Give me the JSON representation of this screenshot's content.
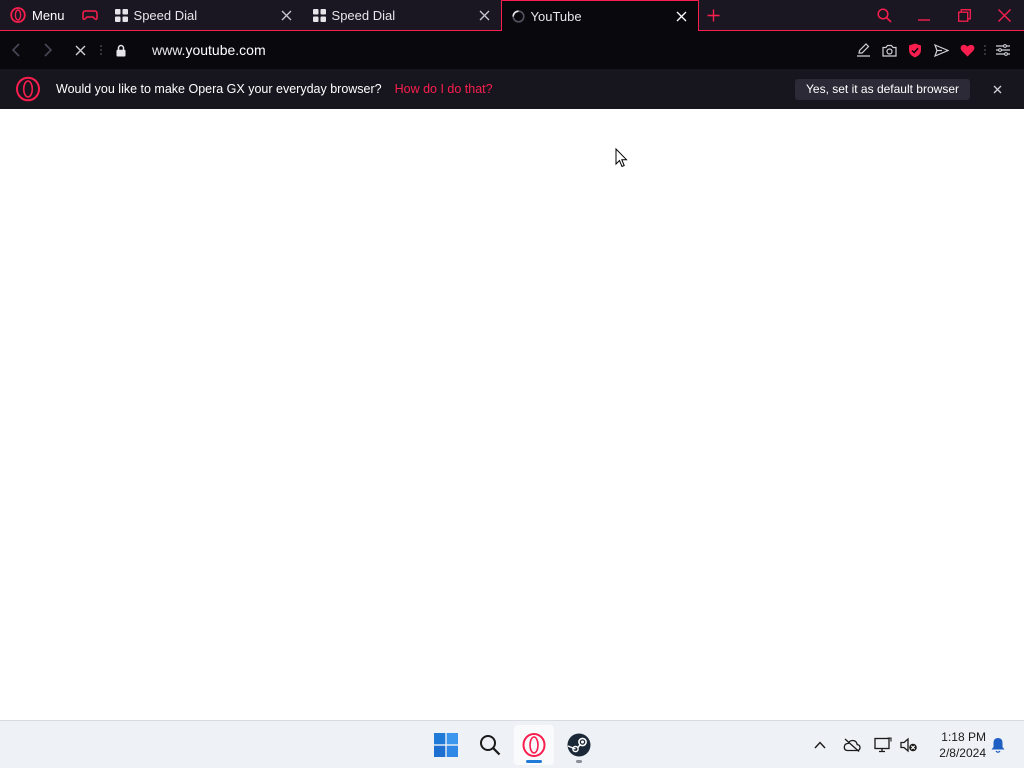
{
  "browser": {
    "menu_label": "Menu",
    "tabs": [
      {
        "title": "Speed Dial",
        "icon": "speed-dial-icon",
        "active": false
      },
      {
        "title": "Speed Dial",
        "icon": "speed-dial-icon",
        "active": false
      },
      {
        "title": "YouTube",
        "icon": "loading-spinner-icon",
        "active": true
      }
    ],
    "accent_color": "#fa1e4e"
  },
  "address": {
    "prefix": "www.",
    "host": "youtube.com"
  },
  "infobar": {
    "message": "Would you like to make Opera GX your everyday browser?",
    "link": "How do I do that?",
    "button": "Yes, set it as default browser"
  },
  "taskbar": {
    "time": "1:18 PM",
    "date": "2/8/2024"
  }
}
